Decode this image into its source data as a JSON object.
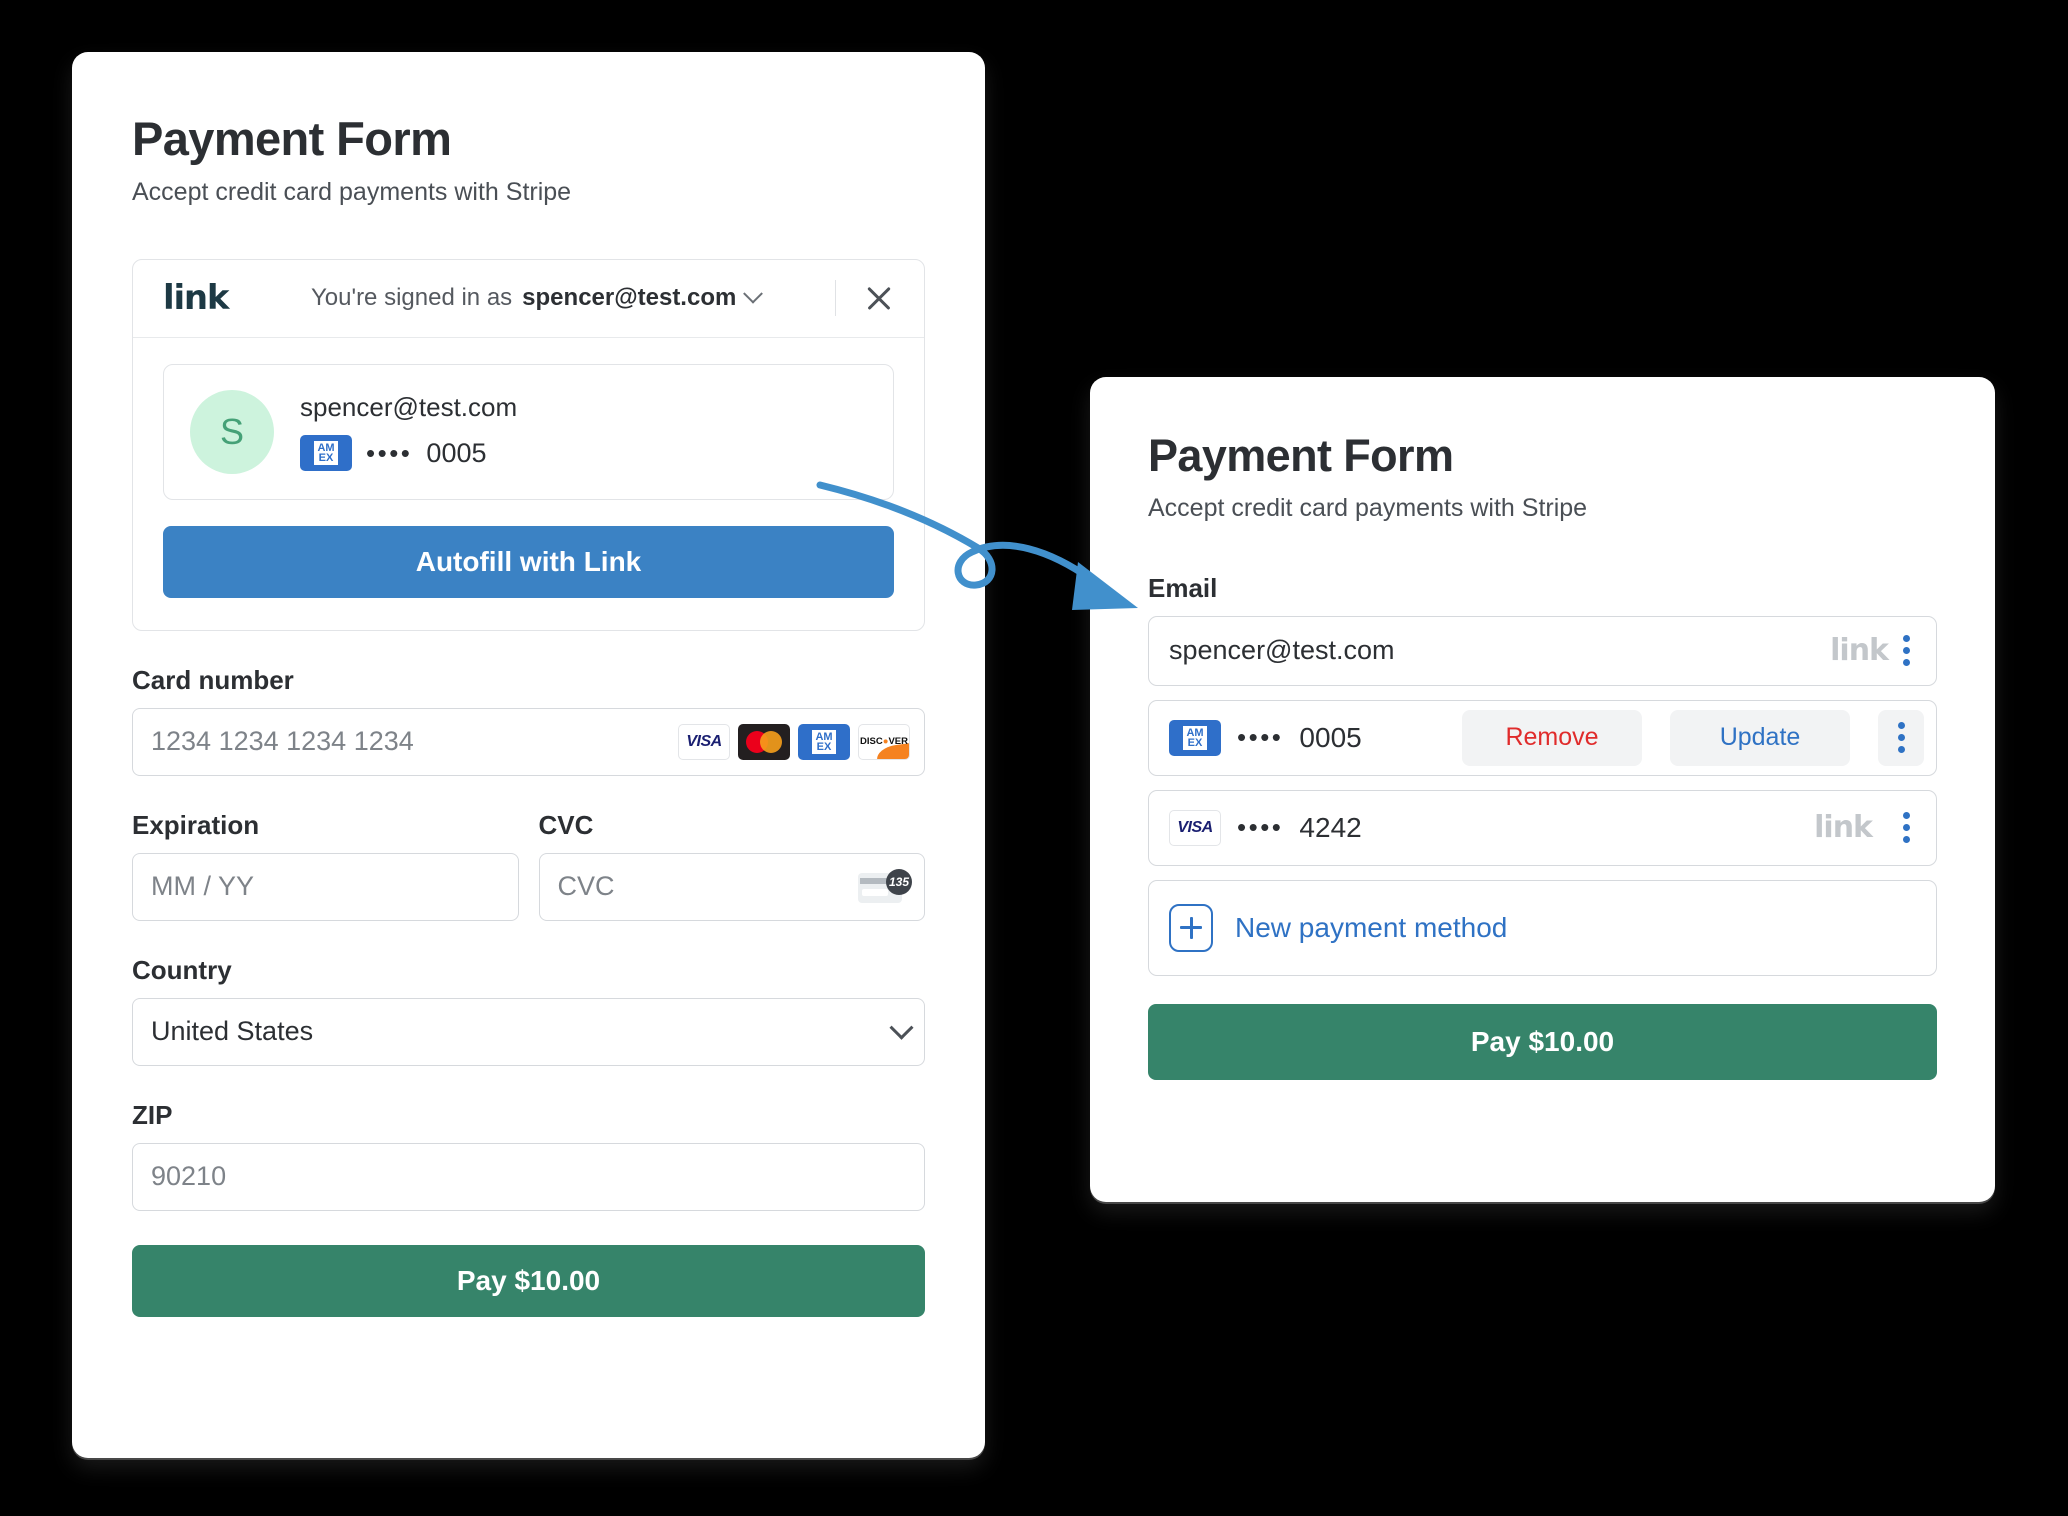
{
  "left_form": {
    "title": "Payment Form",
    "subtitle": "Accept credit card payments with Stripe",
    "link_panel": {
      "logo": "link",
      "signed_in_prefix": "You're signed in as",
      "signed_in_email": "spencer@test.com",
      "chevron_icon": "chevron-down-icon",
      "close_icon": "close-icon",
      "account": {
        "avatar_initial": "S",
        "avatar_bg": "#cdf3dd",
        "avatar_color": "#45a177",
        "email": "spencer@test.com",
        "card_brand": "amex",
        "card_dots": "••••",
        "card_last4": "0005"
      },
      "autofill_button": "Autofill with Link",
      "autofill_color": "#3b82c4"
    },
    "fields": {
      "card_number_label": "Card number",
      "card_number_placeholder": "1234 1234 1234 1234",
      "card_brands": [
        "visa",
        "mastercard",
        "amex",
        "discover"
      ],
      "expiration_label": "Expiration",
      "expiration_placeholder": "MM / YY",
      "cvc_label": "CVC",
      "cvc_placeholder": "CVC",
      "cvc_icon_number": "135",
      "country_label": "Country",
      "country_value": "United States",
      "zip_label": "ZIP",
      "zip_placeholder": "90210"
    },
    "pay_button": "Pay $10.00",
    "pay_color": "#36846a"
  },
  "right_form": {
    "title": "Payment Form",
    "subtitle": "Accept credit card payments with Stripe",
    "email_label": "Email",
    "email_value": "spencer@test.com",
    "email_link_badge": "link",
    "payment_methods": [
      {
        "brand": "amex",
        "dots": "••••",
        "last4": "0005",
        "remove_label": "Remove",
        "update_label": "Update",
        "has_actions": true,
        "link_badge": ""
      },
      {
        "brand": "visa",
        "dots": "••••",
        "last4": "4242",
        "remove_label": "",
        "update_label": "",
        "has_actions": false,
        "link_badge": "link"
      }
    ],
    "new_payment_method": "New payment method",
    "pay_button": "Pay $10.00",
    "pay_color": "#36846a",
    "accent_blue": "#2f72c4",
    "danger_red": "#e02b2b"
  },
  "annotation": {
    "arrow_color": "#4190cc",
    "arrow_style": "curved-loop-arrow"
  }
}
